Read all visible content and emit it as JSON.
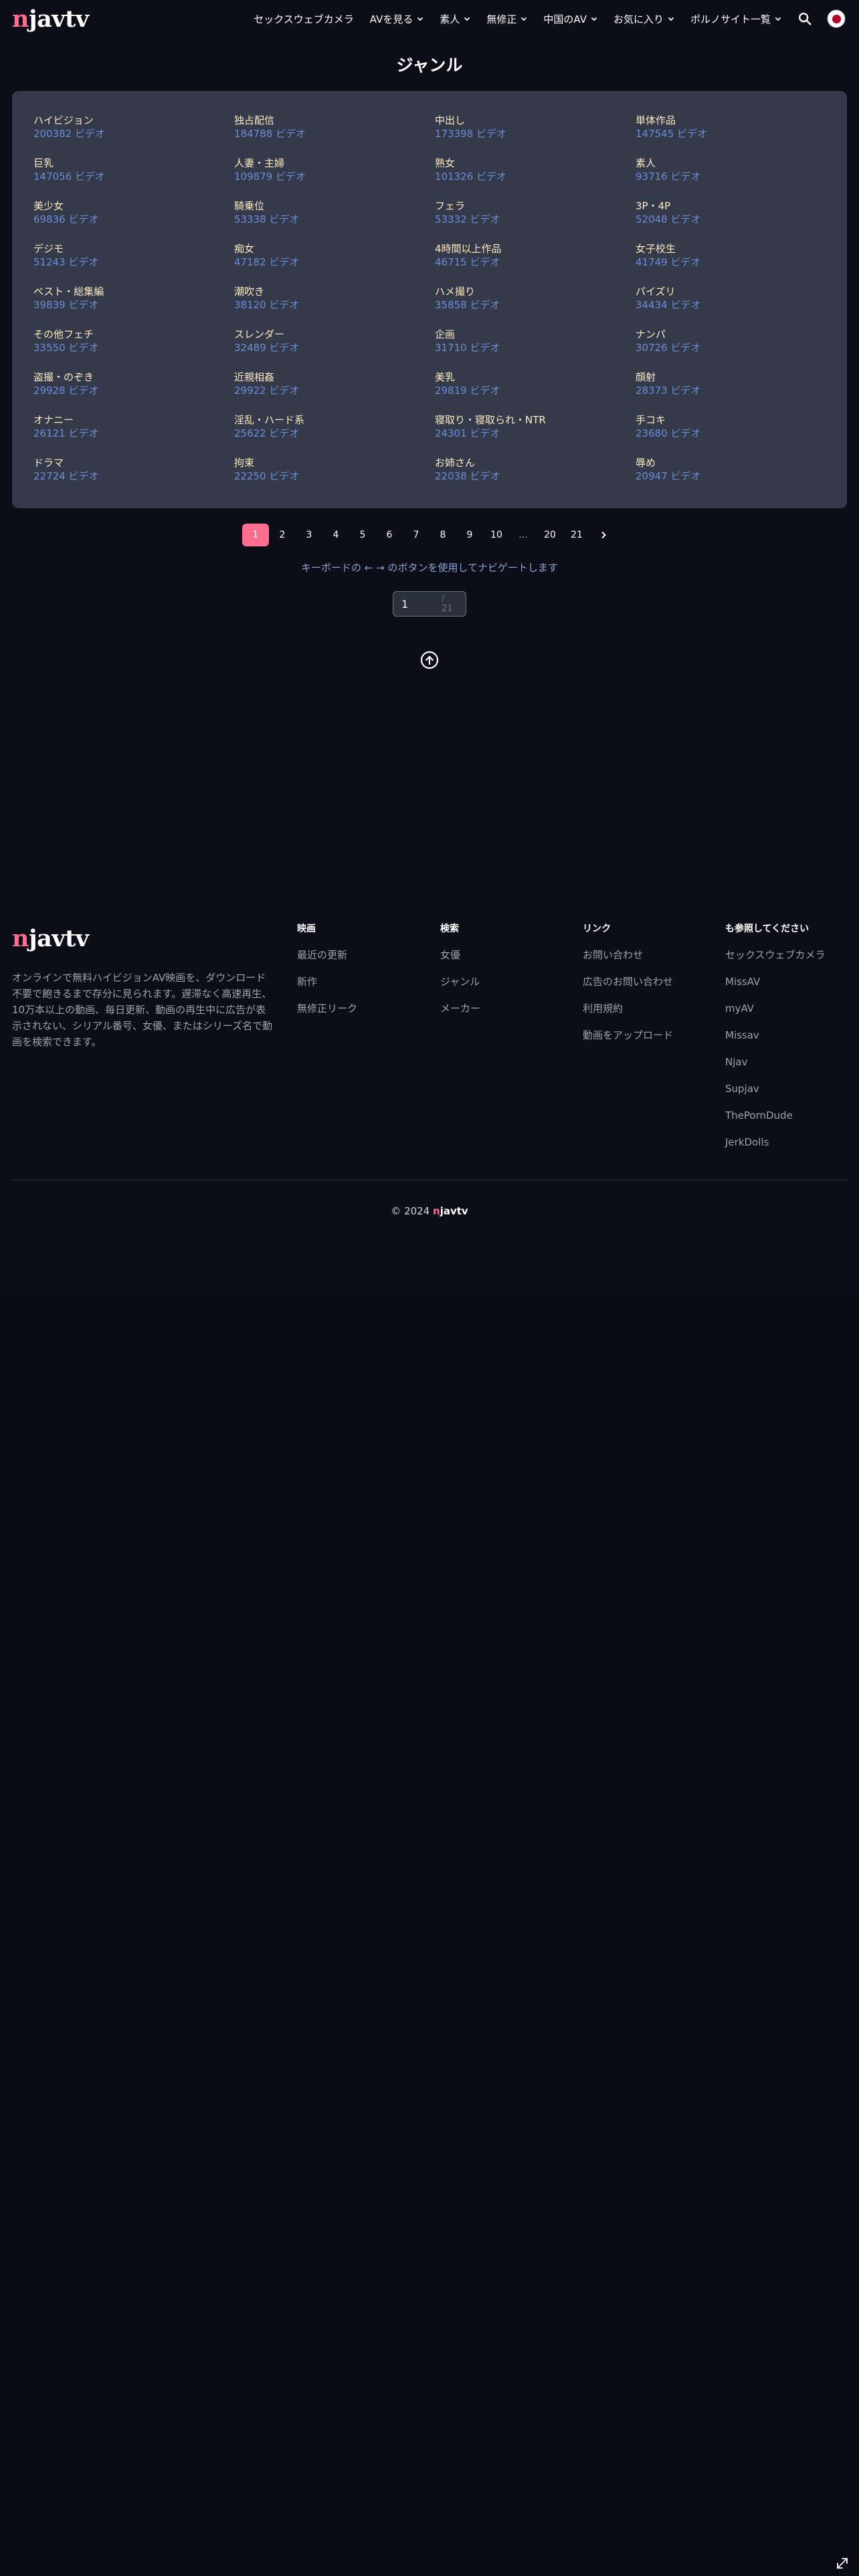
{
  "header": {
    "logo_first": "n",
    "logo_rest": "javtv",
    "nav": [
      {
        "label": "セックスウェブカメラ",
        "dropdown": false
      },
      {
        "label": "AVを見る",
        "dropdown": true
      },
      {
        "label": "素人",
        "dropdown": true
      },
      {
        "label": "無修正",
        "dropdown": true
      },
      {
        "label": "中国のAV",
        "dropdown": true
      },
      {
        "label": "お気に入り",
        "dropdown": true
      },
      {
        "label": "ポルノサイト一覧",
        "dropdown": true
      }
    ],
    "search_icon": "search-icon",
    "language_icon": "japan-flag-icon"
  },
  "page_title": "ジャンル",
  "genres": [
    {
      "name": "ハイビジョン",
      "count": "200382 ビデオ"
    },
    {
      "name": "独占配信",
      "count": "184788 ビデオ"
    },
    {
      "name": "中出し",
      "count": "173398 ビデオ"
    },
    {
      "name": "単体作品",
      "count": "147545 ビデオ"
    },
    {
      "name": "巨乳",
      "count": "147056 ビデオ"
    },
    {
      "name": "人妻・主婦",
      "count": "109879 ビデオ"
    },
    {
      "name": "熟女",
      "count": "101326 ビデオ"
    },
    {
      "name": "素人",
      "count": "93716 ビデオ"
    },
    {
      "name": "美少女",
      "count": "69836 ビデオ"
    },
    {
      "name": "騎乗位",
      "count": "53338 ビデオ"
    },
    {
      "name": "フェラ",
      "count": "53332 ビデオ"
    },
    {
      "name": "3P・4P",
      "count": "52048 ビデオ"
    },
    {
      "name": "デジモ",
      "count": "51243 ビデオ"
    },
    {
      "name": "痴女",
      "count": "47182 ビデオ"
    },
    {
      "name": "4時間以上作品",
      "count": "46715 ビデオ"
    },
    {
      "name": "女子校生",
      "count": "41749 ビデオ"
    },
    {
      "name": "ベスト・総集編",
      "count": "39839 ビデオ"
    },
    {
      "name": "潮吹き",
      "count": "38120 ビデオ"
    },
    {
      "name": "ハメ撮り",
      "count": "35858 ビデオ"
    },
    {
      "name": "パイズリ",
      "count": "34434 ビデオ"
    },
    {
      "name": "その他フェチ",
      "count": "33550 ビデオ"
    },
    {
      "name": "スレンダー",
      "count": "32489 ビデオ"
    },
    {
      "name": "企画",
      "count": "31710 ビデオ"
    },
    {
      "name": "ナンパ",
      "count": "30726 ビデオ"
    },
    {
      "name": "盗撮・のぞき",
      "count": "29928 ビデオ"
    },
    {
      "name": "近親相姦",
      "count": "29922 ビデオ"
    },
    {
      "name": "美乳",
      "count": "29819 ビデオ"
    },
    {
      "name": "顔射",
      "count": "28373 ビデオ"
    },
    {
      "name": "オナニー",
      "count": "26121 ビデオ"
    },
    {
      "name": "淫乱・ハード系",
      "count": "25622 ビデオ"
    },
    {
      "name": "寝取り・寝取られ・NTR",
      "count": "24301 ビデオ"
    },
    {
      "name": "手コキ",
      "count": "23680 ビデオ"
    },
    {
      "name": "ドラマ",
      "count": "22724 ビデオ"
    },
    {
      "name": "拘束",
      "count": "22250 ビデオ"
    },
    {
      "name": "お姉さん",
      "count": "22038 ビデオ"
    },
    {
      "name": "辱め",
      "count": "20947 ビデオ"
    }
  ],
  "pagination": {
    "pages": [
      "1",
      "2",
      "3",
      "4",
      "5",
      "6",
      "7",
      "8",
      "9",
      "10",
      "...",
      "20",
      "21"
    ],
    "current": "1",
    "next_icon": "chevron-right-icon",
    "hint": "キーボードの ← → のボタンを使用してナビゲートします",
    "input_value": "1",
    "total_label": "/ 21"
  },
  "back_to_top_icon": "arrow-up-circle-icon",
  "footer": {
    "logo_first": "n",
    "logo_rest": "javtv",
    "description": "オンラインで無料ハイビジョンAV映画を、ダウンロード不要で飽きるまで存分に見られます。遅滞なく高速再生、10万本以上の動画、毎日更新、動画の再生中に広告が表示されない、シリアル番号、女優、またはシリーズ名で動画を検索できます。",
    "columns": [
      {
        "title": "映画",
        "links": [
          "最近の更新",
          "新作",
          "無修正リーク"
        ]
      },
      {
        "title": "検索",
        "links": [
          "女優",
          "ジャンル",
          "メーカー"
        ]
      },
      {
        "title": "リンク",
        "links": [
          "お問い合わせ",
          "広告のお問い合わせ",
          "利用規約",
          "動画をアップロード"
        ]
      },
      {
        "title": "も参照してください",
        "links": [
          "セックスウェブカメラ",
          "MissAV",
          "myAV",
          "Missav",
          "Njav",
          "Supjav",
          "ThePornDude",
          "JerkDolls"
        ]
      }
    ],
    "copyright_prefix": "© 2024 ",
    "brand_first": "n",
    "brand_rest": "javtv"
  },
  "colors": {
    "accent": "#ff6d91",
    "panel": "#343a4a",
    "genre_name": "#fde9c2",
    "genre_count": "#6a8cdb",
    "background": "#0c0d16"
  }
}
